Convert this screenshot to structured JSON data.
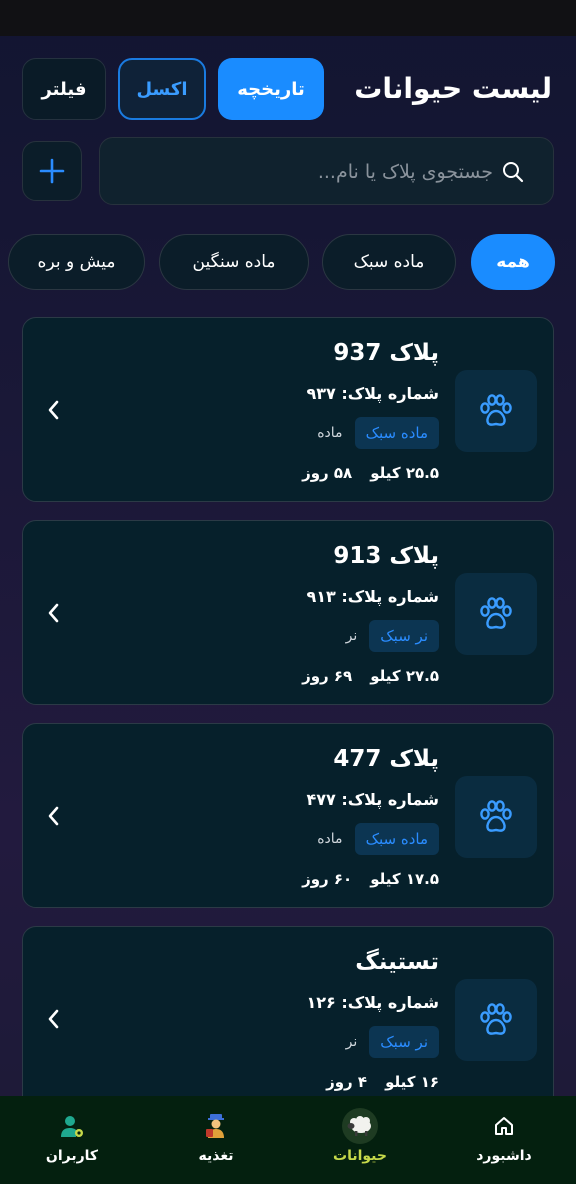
{
  "header": {
    "title": "لیست حیوانات",
    "history_label": "تاریخچه",
    "excel_label": "اکسل",
    "filter_label": "فیلتر"
  },
  "search": {
    "placeholder": "جستجوی پلاک یا نام..."
  },
  "filters": [
    {
      "label": "همه",
      "active": true
    },
    {
      "label": "ماده سبک",
      "active": false
    },
    {
      "label": "ماده سنگین",
      "active": false
    },
    {
      "label": "میش و بره",
      "active": false
    }
  ],
  "animals": [
    {
      "title": "پلاک 937",
      "plate": "شماره پلاک: ۹۳۷",
      "type": "ماده سبک",
      "sex": "ماده",
      "weight": "۲۵.۵ کیلو",
      "age": "۵۸ روز"
    },
    {
      "title": "پلاک 913",
      "plate": "شماره پلاک: ۹۱۳",
      "type": "نر سبک",
      "sex": "نر",
      "weight": "۲۷.۵ کیلو",
      "age": "۶۹ روز"
    },
    {
      "title": "پلاک 477",
      "plate": "شماره پلاک: ۴۷۷",
      "type": "ماده سبک",
      "sex": "ماده",
      "weight": "۱۷.۵ کیلو",
      "age": "۶۰ روز"
    },
    {
      "title": "تستینگ",
      "plate": "شماره پلاک: ۱۲۶",
      "type": "نر سبک",
      "sex": "نر",
      "weight": "۱۶ کیلو",
      "age": "۴ روز"
    }
  ],
  "nav": {
    "dashboard": "داشبورد",
    "animals": "حیوانات",
    "feeding": "تغذیه",
    "users": "کاربران"
  },
  "colors": {
    "accent": "#1a8cff",
    "nav_active": "#c6d94a",
    "card_bg": "#06202b"
  }
}
